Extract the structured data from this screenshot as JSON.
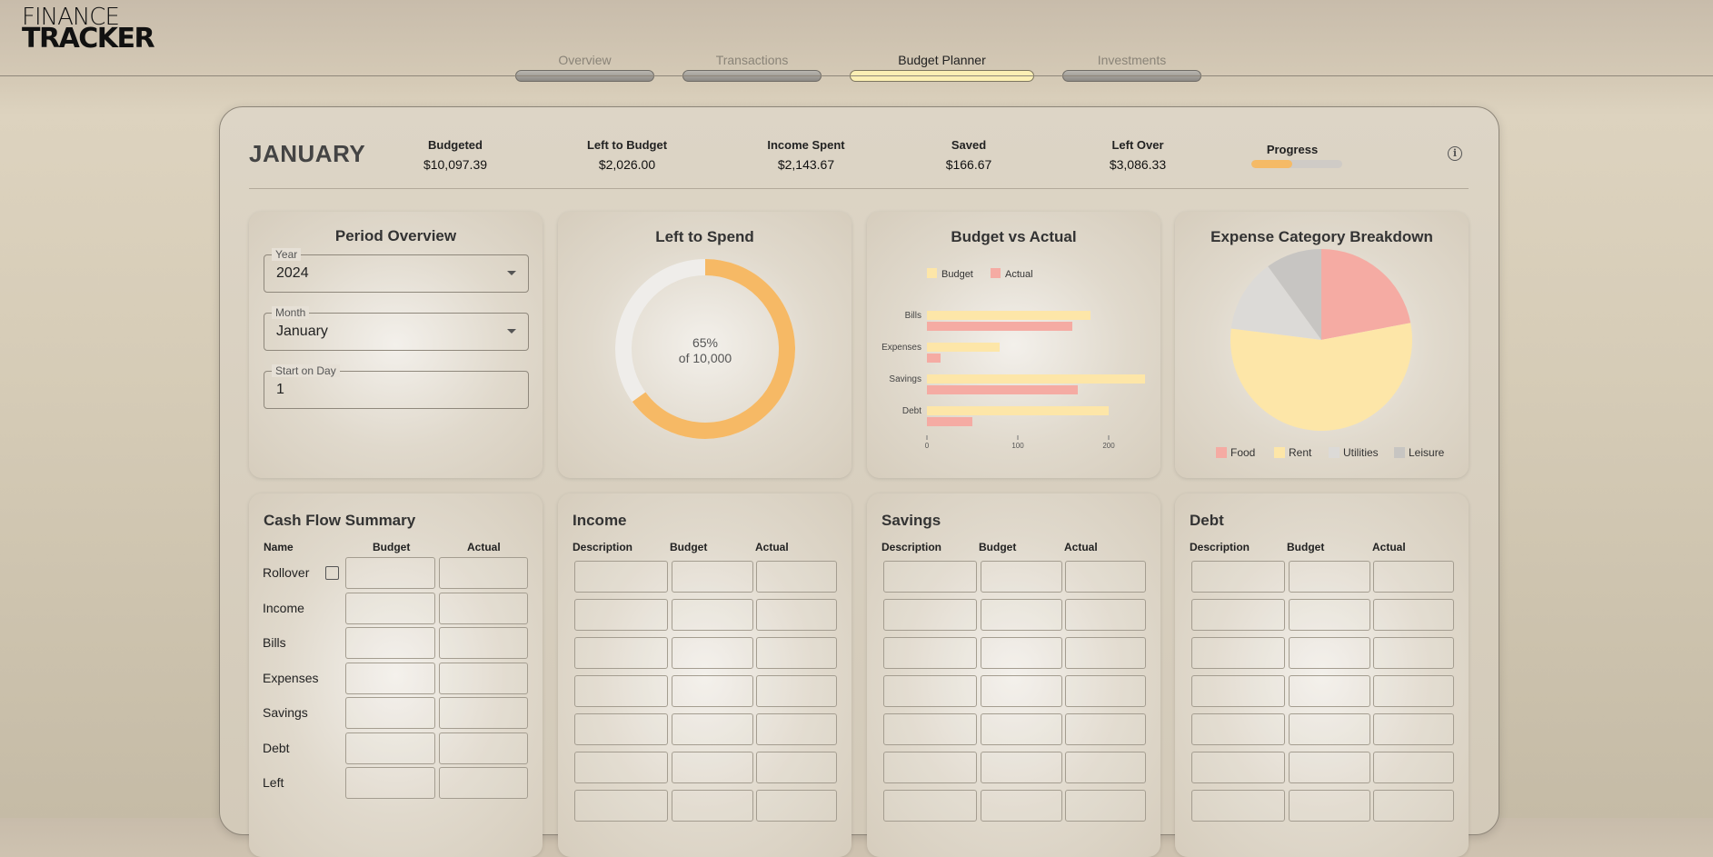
{
  "logo": {
    "line1": "FINANCE",
    "line2": "TRACKER"
  },
  "tabs": [
    {
      "label": "Overview",
      "active": false
    },
    {
      "label": "Transactions",
      "active": false
    },
    {
      "label": "Budget Planner",
      "active": true
    },
    {
      "label": "Investments",
      "active": false
    }
  ],
  "summary": {
    "month": "JANUARY",
    "stats": [
      {
        "label": "Budgeted",
        "value": "$10,097.39"
      },
      {
        "label": "Left to Budget",
        "value": "$2,026.00"
      },
      {
        "label": "Income Spent",
        "value": "$2,143.67"
      },
      {
        "label": "Saved",
        "value": "$166.67"
      },
      {
        "label": "Left Over",
        "value": "$3,086.33"
      }
    ],
    "progress_label": "Progress",
    "progress_fraction": 0.45,
    "info_icon": "info-icon"
  },
  "period": {
    "title": "Period Overview",
    "year_label": "Year",
    "year_value": "2024",
    "month_label": "Month",
    "month_value": "January",
    "start_label": "Start on Day",
    "start_value": "1"
  },
  "left_to_spend": {
    "title": "Left to Spend",
    "percent_text": "65%",
    "of_text": "of 10,000",
    "fraction": 0.65
  },
  "budget_vs_actual": {
    "title": "Budget vs Actual",
    "chart_data": {
      "type": "bar",
      "orientation": "horizontal",
      "categories": [
        "Bills",
        "Expenses",
        "Savings",
        "Debt"
      ],
      "series": [
        {
          "name": "Budget",
          "values": [
            180,
            80,
            240,
            200
          ],
          "color": "#fde6a8"
        },
        {
          "name": "Actual",
          "values": [
            160,
            15,
            166,
            50
          ],
          "color": "#f5aba3"
        }
      ],
      "xticks": [
        "0",
        "100",
        "200"
      ],
      "xlim": [
        0,
        240
      ],
      "legend": "top"
    }
  },
  "expense_breakdown": {
    "title": "Expense Category Breakdown",
    "chart_data": {
      "type": "pie",
      "labels": [
        "Food",
        "Rent",
        "Utilities",
        "Leisure"
      ],
      "values": [
        22,
        55,
        13,
        10
      ],
      "colors": [
        "#f5aba3",
        "#fde6a8",
        "#dcdad7",
        "#c7c5c2"
      ],
      "legend": "bottom"
    }
  },
  "cash_flow": {
    "title": "Cash Flow Summary",
    "headers": [
      "Name",
      "Budget",
      "Actual"
    ],
    "rows": [
      "Rollover",
      "Income",
      "Bills",
      "Expenses",
      "Savings",
      "Debt",
      "Left"
    ]
  },
  "income": {
    "title": "Income",
    "headers": [
      "Description",
      "Budget",
      "Actual"
    ]
  },
  "savings": {
    "title": "Savings",
    "headers": [
      "Description",
      "Budget",
      "Actual"
    ]
  },
  "debt": {
    "title": "Debt",
    "headers": [
      "Description",
      "Budget",
      "Actual"
    ]
  }
}
